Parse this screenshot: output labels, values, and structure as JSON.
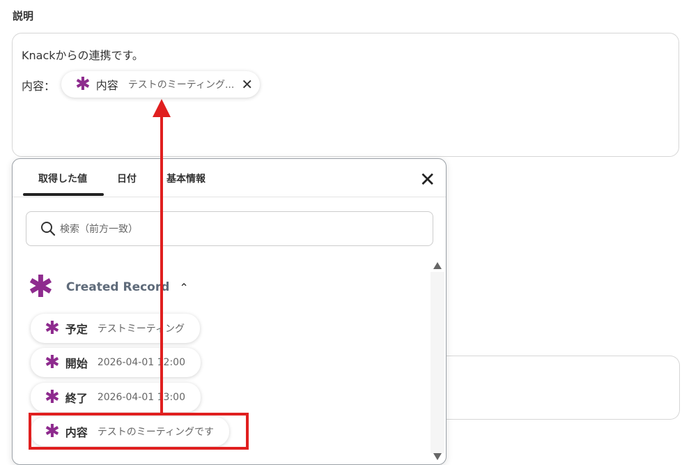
{
  "section": {
    "label": "説明"
  },
  "description": {
    "line1": "Knackからの連携です。",
    "line2_label": "内容：",
    "inserted_chip": {
      "icon": "knack-asterisk-icon",
      "name": "内容",
      "value": "テストのミーティング...",
      "close": "✕"
    }
  },
  "panel": {
    "tabs": [
      {
        "label": "取得した値",
        "active": true
      },
      {
        "label": "日付",
        "active": false
      },
      {
        "label": "基本情報",
        "active": false
      }
    ],
    "close": "✕",
    "search": {
      "placeholder": "検索（前方一致）"
    },
    "group": {
      "title": "Created Record",
      "chevron": "⌃",
      "icon": "knack-asterisk-icon"
    },
    "items": [
      {
        "name": "予定",
        "value": "テストミーティング"
      },
      {
        "name": "開始",
        "value": "2026-04-01 12:00"
      },
      {
        "name": "終了",
        "value": "2026-04-01 13:00"
      },
      {
        "name": "内容",
        "value": "テストのミーティングです"
      }
    ]
  },
  "colors": {
    "accent": "#8e2b8e",
    "highlight": "#e01f1f"
  },
  "icon_glyph": "✱"
}
